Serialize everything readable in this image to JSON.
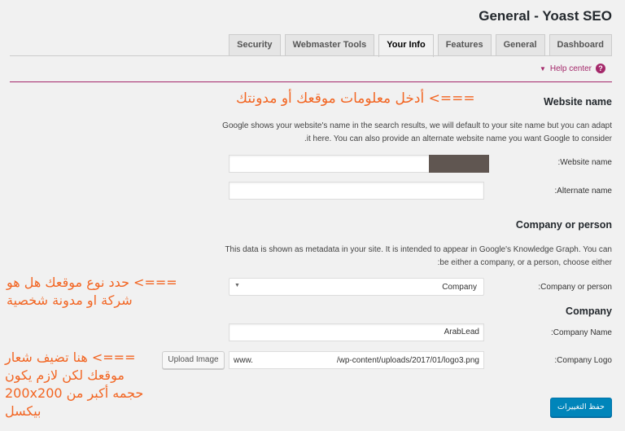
{
  "header": {
    "title": "General - Yoast SEO",
    "tabs": [
      {
        "label": "Security"
      },
      {
        "label": "Webmaster Tools"
      },
      {
        "label": "Your Info"
      },
      {
        "label": "Features"
      },
      {
        "label": "General"
      },
      {
        "label": "Dashboard"
      }
    ],
    "active_tab": "Your Info",
    "help_center": "Help center",
    "help_icon": "?"
  },
  "website": {
    "title": "Website name",
    "description": "Google shows your website's name in the search results, we will default to your site name but you can adapt it here. You can also provide an alternate website name you want Google to consider.",
    "name_label": ":Website name",
    "name_value": "",
    "alt_label": ":Alternate name",
    "alt_value": ""
  },
  "company_or_person": {
    "title": "Company or person",
    "description": "This data is shown as metadata in your site. It is intended to appear in Google's Knowledge Graph. You can be either a company, or a person, choose either:",
    "select_label": ":Company or person",
    "select_value": "Company"
  },
  "company": {
    "title": "Company",
    "name_label": ":Company Name",
    "name_value": "ArabLead",
    "logo_label": ":Company Logo",
    "logo_prefix": "www.",
    "logo_path": "/wp-content/uploads/2017/01/logo3.png",
    "upload_label": "Upload Image"
  },
  "save_label": "حفظ التغييرات",
  "annotations": {
    "a1": "===> أدخل معلومات موقعك أو مدونتك",
    "a2_line1": "===> حدد نوع موقعك هل هو",
    "a2_line2": "شركة او مدونة شخصية",
    "a3_line1": "===> هنا تضيف شعار",
    "a3_line2": "موقعك لكن لازم يكون",
    "a3_line3": "حجمه أكبر من 200x200",
    "a3_line4": "بيكسل"
  },
  "colors": {
    "accent": "#a4286a",
    "primary_button": "#0085ba",
    "annotation": "#f26522"
  }
}
